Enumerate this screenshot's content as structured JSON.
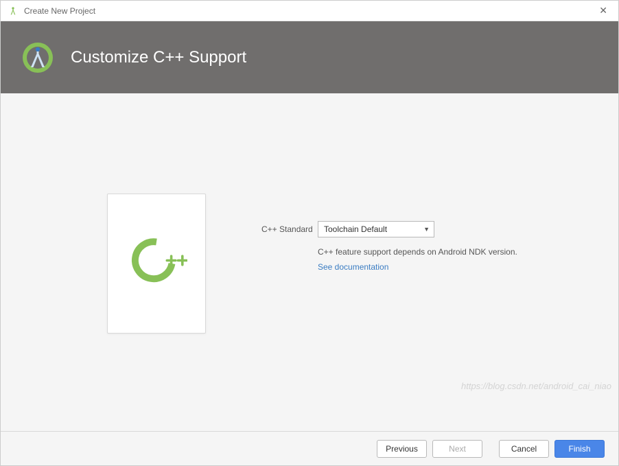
{
  "window": {
    "title": "Create New Project"
  },
  "header": {
    "title": "Customize C++ Support"
  },
  "form": {
    "standard_label": "C++ Standard",
    "standard_value": "Toolchain Default",
    "description": "C++ feature support depends on Android NDK version.",
    "doc_link": "See documentation"
  },
  "footer": {
    "previous": "Previous",
    "next": "Next",
    "cancel": "Cancel",
    "finish": "Finish"
  },
  "watermark": "https://blog.csdn.net/android_cai_niao"
}
